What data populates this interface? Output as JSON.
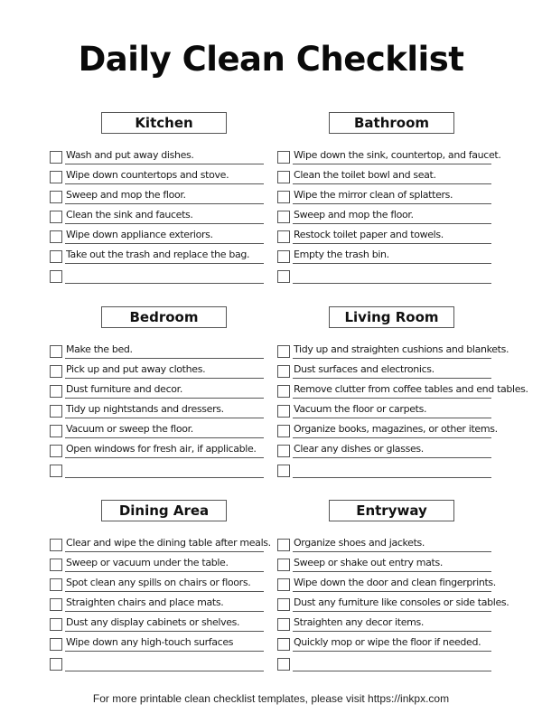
{
  "title": "Daily Clean Checklist",
  "sections": [
    {
      "heading": "Kitchen",
      "items": [
        "Wash and put away dishes.",
        "Wipe down countertops and stove.",
        "Sweep and mop the floor.",
        "Clean the sink and faucets.",
        "Wipe down appliance exteriors.",
        "Take out the trash and replace the bag.",
        ""
      ]
    },
    {
      "heading": "Bathroom",
      "items": [
        "Wipe down the sink, countertop, and faucet.",
        "Clean the toilet bowl and seat.",
        "Wipe the mirror clean of splatters.",
        "Sweep and mop the floor.",
        "Restock toilet paper and towels.",
        "Empty the trash bin.",
        ""
      ]
    },
    {
      "heading": "Bedroom",
      "items": [
        "Make the bed.",
        "Pick up and put away clothes.",
        "Dust furniture and decor.",
        "Tidy up nightstands and dressers.",
        "Vacuum or sweep the floor.",
        "Open windows for fresh air, if applicable.",
        ""
      ]
    },
    {
      "heading": "Living Room",
      "items": [
        "Tidy up and straighten cushions and blankets.",
        "Dust surfaces and electronics.",
        "Remove clutter from coffee tables and end tables.",
        "Vacuum the floor or carpets.",
        "Organize books, magazines, or other items.",
        "Clear any dishes or glasses.",
        ""
      ]
    },
    {
      "heading": "Dining Area",
      "items": [
        "Clear and wipe the dining table after meals.",
        "Sweep or vacuum under the table.",
        "Spot clean any spills on chairs or floors.",
        "Straighten chairs and place mats.",
        "Dust any display cabinets or shelves.",
        "Wipe down any high-touch surfaces",
        ""
      ]
    },
    {
      "heading": "Entryway",
      "items": [
        "Organize shoes and jackets.",
        "Sweep or shake out entry mats.",
        "Wipe down the door and clean fingerprints.",
        "Dust any furniture like consoles or side tables.",
        "Straighten any decor items.",
        "Quickly mop or wipe the floor if needed.",
        ""
      ]
    }
  ],
  "footer": "For more printable clean checklist templates, please visit https://inkpx.com"
}
